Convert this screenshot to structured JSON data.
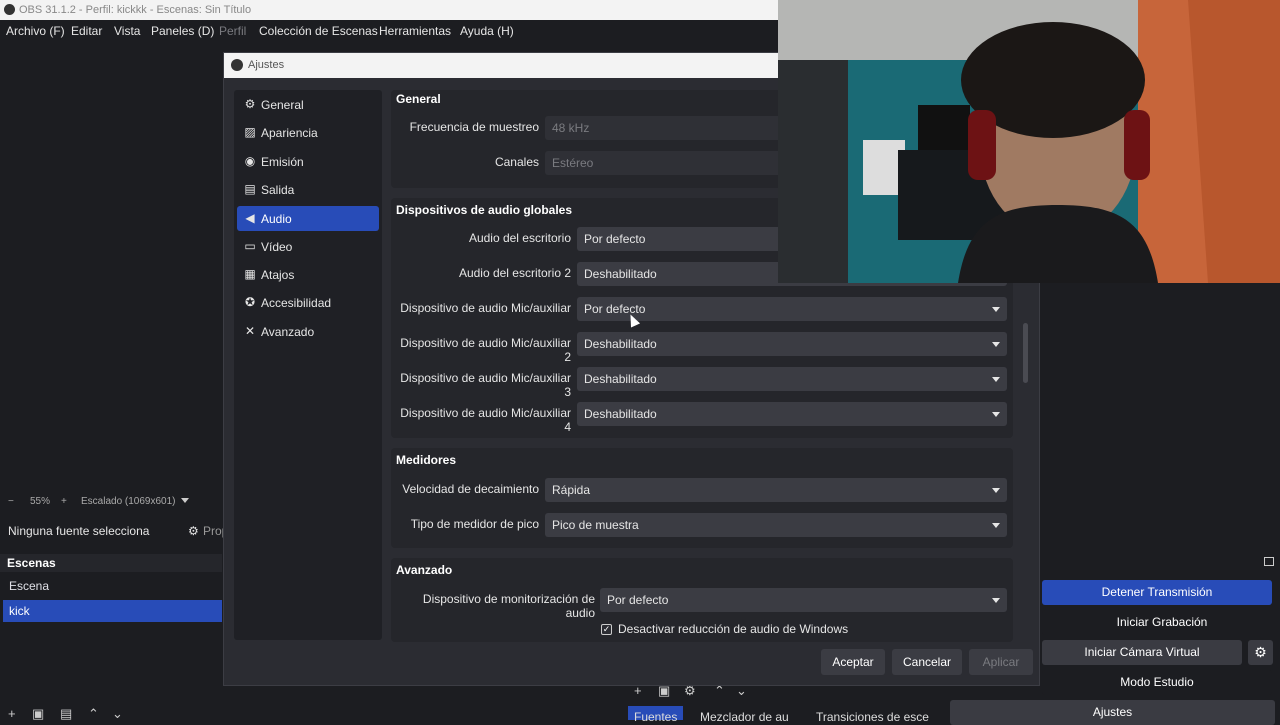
{
  "window": {
    "title": "OBS 31.1.2 - Perfil: kickkk - Escenas: Sin Título"
  },
  "menu": [
    "Archivo (F)",
    "Editar",
    "Vista",
    "Paneles (D)",
    "Perfil",
    "Colección de Escenas",
    "Herramientas",
    "Ayuda (H)"
  ],
  "preview": {
    "zoom_minus": "−",
    "zoom": "55%",
    "zoom_plus": "+",
    "scale": "Escalado (1069x601)",
    "no_source": "Ninguna fuente selecciona",
    "props": "Prop"
  },
  "scenes": {
    "title": "Escenas",
    "items": [
      "Escena",
      "kick"
    ]
  },
  "controls": {
    "stop_stream": "Detener Transmisión",
    "start_record": "Iniciar Grabación",
    "virtual_cam": "Iniciar Cámara Virtual",
    "studio": "Modo Estudio",
    "settings": "Ajustes"
  },
  "bottom_tabs": [
    "Fuentes",
    "Mezclador de au",
    "Transiciones de esce"
  ],
  "dialog": {
    "title": "Ajustes",
    "sidebar": [
      "General",
      "Apariencia",
      "Emisión",
      "Salida",
      "Audio",
      "Vídeo",
      "Atajos",
      "Accesibilidad",
      "Avanzado"
    ],
    "general": {
      "title": "General",
      "sample_rate_label": "Frecuencia de muestreo",
      "sample_rate": "48 kHz",
      "channels_label": "Canales",
      "channels": "Estéreo"
    },
    "devices": {
      "title": "Dispositivos de audio globales",
      "rows": [
        {
          "label": "Audio del escritorio",
          "value": "Por defecto"
        },
        {
          "label": "Audio del escritorio 2",
          "value": "Deshabilitado"
        },
        {
          "label": "Dispositivo de audio Mic/auxiliar",
          "value": "Por defecto"
        },
        {
          "label": "Dispositivo de audio Mic/auxiliar 2",
          "value": "Deshabilitado"
        },
        {
          "label": "Dispositivo de audio Mic/auxiliar 3",
          "value": "Deshabilitado"
        },
        {
          "label": "Dispositivo de audio Mic/auxiliar 4",
          "value": "Deshabilitado"
        }
      ]
    },
    "meters": {
      "title": "Medidores",
      "decay_label": "Velocidad de decaimiento",
      "decay": "Rápida",
      "peak_label": "Tipo de medidor de pico",
      "peak": "Pico de muestra"
    },
    "advanced": {
      "title": "Avanzado",
      "monitor_label": "Dispositivo de monitorización de audio",
      "monitor": "Por defecto",
      "ducking_label": "Desactivar reducción de audio de Windows",
      "ducking_checked": true
    },
    "buttons": {
      "ok": "Aceptar",
      "cancel": "Cancelar",
      "apply": "Aplicar"
    }
  }
}
